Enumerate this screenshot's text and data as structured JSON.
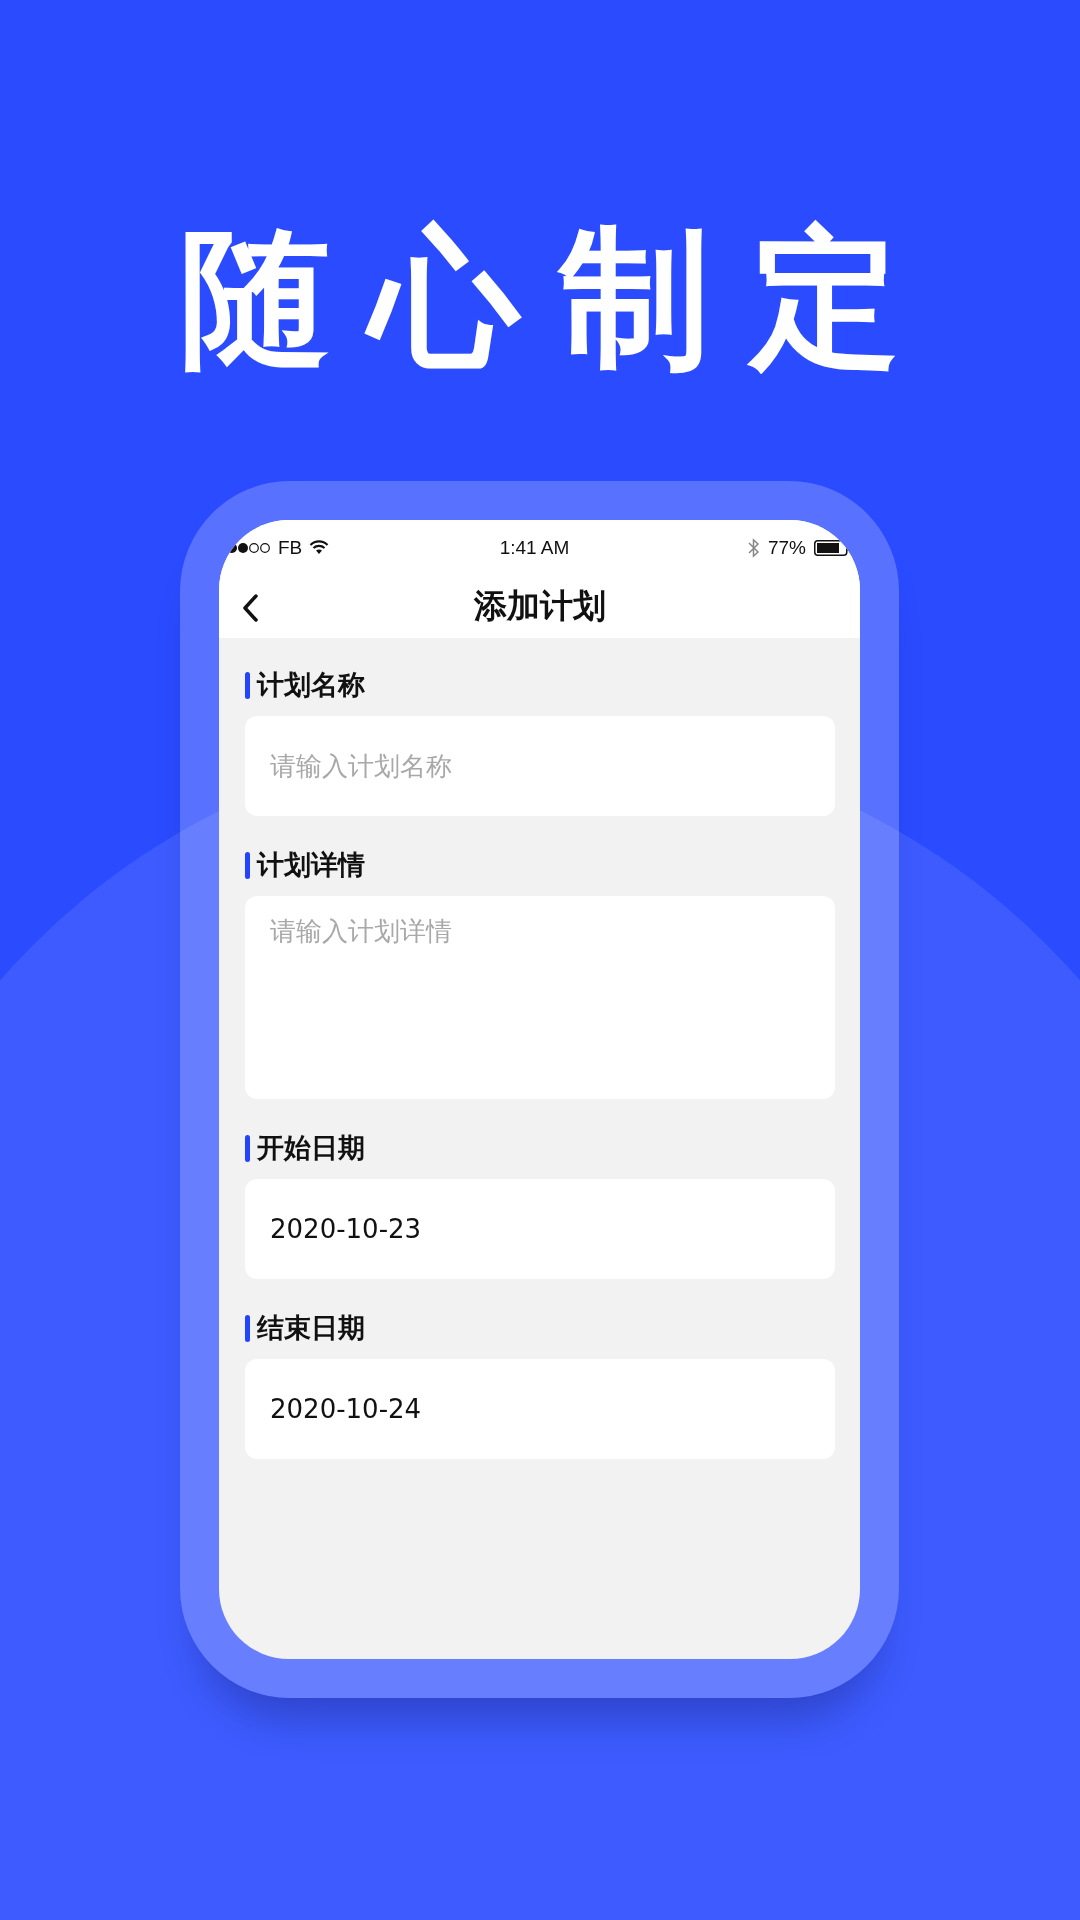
{
  "headline": "随心制定",
  "status_bar": {
    "carrier": "FB",
    "time": "1:41 AM",
    "battery": "77%"
  },
  "nav": {
    "title": "添加计划"
  },
  "form": [
    {
      "label": "计划名称",
      "kind": "input",
      "placeholder": "请输入计划名称"
    },
    {
      "label": "计划详情",
      "kind": "textarea",
      "placeholder": "请输入计划详情"
    },
    {
      "label": "开始日期",
      "kind": "input",
      "value": "2020-10-23"
    },
    {
      "label": "结束日期",
      "kind": "input",
      "value": "2020-10-24"
    }
  ]
}
